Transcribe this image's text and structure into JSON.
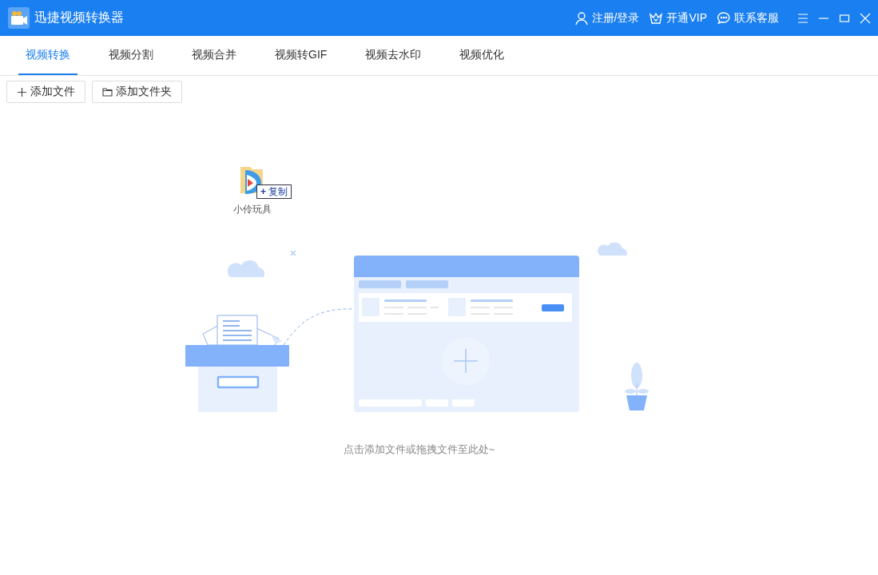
{
  "window": {
    "title": "迅捷视频转换器"
  },
  "header_links": [
    {
      "kind": "user",
      "label": "注册/登录"
    },
    {
      "kind": "vip",
      "label": "开通VIP"
    },
    {
      "kind": "chat",
      "label": "联系客服"
    }
  ],
  "tabs": [
    {
      "label": "视频转换",
      "selected": true
    },
    {
      "label": "视频分割",
      "selected": false
    },
    {
      "label": "视频合并",
      "selected": false
    },
    {
      "label": "视频转GIF",
      "selected": false
    },
    {
      "label": "视频去水印",
      "selected": false
    },
    {
      "label": "视频优化",
      "selected": false
    }
  ],
  "toolbar": [
    {
      "kind": "file",
      "label": "添加文件"
    },
    {
      "kind": "folder",
      "label": "添加文件夹"
    }
  ],
  "drag_item": {
    "name": "小伶玩具",
    "action": "复制",
    "action_symbol": "+"
  },
  "drop_hint": "点击添加文件或拖拽文件至此处~"
}
